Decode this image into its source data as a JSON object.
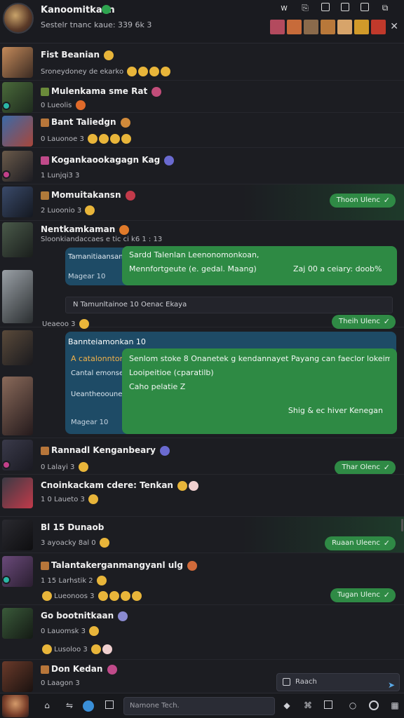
{
  "header": {
    "title": "Kanoomitkaan",
    "subtitle": "Sestelr tnanc kaue: 339 6k 3",
    "icons": [
      "wifi-icon",
      "clip-icon",
      "window-icon",
      "box-icon",
      "square-icon",
      "restore-icon"
    ],
    "thumb_colors": [
      "#b34a5e",
      "#c76b3a",
      "#8a6a4b",
      "#b8783a",
      "#d7a46a",
      "#d19a2a",
      "#c0392b"
    ]
  },
  "chats": [
    {
      "name": "Fist Beanian",
      "preview": "Sroneydoney de ekarko",
      "color": "#c48a5a"
    },
    {
      "name": "Mulenkama sme Rat",
      "preview": "0  Lueolis",
      "color": "#4a6a3a"
    },
    {
      "name": "Bant Taliedgn",
      "preview": "0  Lauonoe 3",
      "color": "#3a6aa8"
    },
    {
      "name": "Kogankaookagagn Kag",
      "preview": "1  Lunjqi3 3",
      "color": "#6a5a4a"
    },
    {
      "name": "Momuitakansn",
      "preview": "2  Luoonio 3",
      "color": "#3a4a6a",
      "pill": "Thoon Ulenc"
    },
    {
      "name": "Nentkamkaman",
      "preview": "Sloonkiandaccaes e tic ci k6 1 : 13",
      "color": "#4a5a4a"
    },
    {
      "name": "Rannadl Kenganbeary",
      "preview": "0  Lalayi 3",
      "color": "#3a3a4a"
    },
    {
      "name": "Cnoinkackam cdere: Tenkan",
      "preview": "1 0  Laueto 3",
      "color": "#3a3a44"
    },
    {
      "name": "Bl 15 Dunaob",
      "preview": "3  ayoacky 8al 0",
      "color": "#2a2a30",
      "pill": "Ruaan Uleenc"
    },
    {
      "name": "Talantakerganmangyanl ulg",
      "preview": "1  15  Larhstik 2",
      "color": "#6a4a7a",
      "pill": "Tugan Ulenc"
    },
    {
      "name": "Go bootnitkaan",
      "preview": "0  Lauomsk 3",
      "color": "#3a5a3a"
    },
    {
      "name": "Don Kedan",
      "preview": "0  Laagon 3",
      "color": "#6a3a2a"
    }
  ],
  "thread1": {
    "blue_title": "Tamanitiaansan",
    "blue_line": "Magear 10",
    "green_line1": "Sardd  Talenlan Leenonomonkoan,",
    "green_line2": "Mennfortgeute (e. gedal. Maang)",
    "green_line3": "Zaj 00 a ceiary: doob%",
    "sub": "N  Tamunltainoe 10  Oenac  Ekaya",
    "pill": "Theih Ulenc",
    "footer": "Ueaeoo 3"
  },
  "thread2": {
    "blue_title": "Bannteiamonkan 10",
    "blue_line1": "A catalonnton",
    "blue_line2": "Cantal emonse",
    "blue_line3": "Ueantheooune",
    "blue_line4": "Magear 10",
    "green_line1": "Senlom stoke 8 Onanetek g kendannayet Payang can faeclor lokeim",
    "green_line2": "Looipeitioe (cparatilb)",
    "green_line3": "Caho pelatie Z",
    "green_line4": "Shig & ec hiver Kenegan",
    "pill": "Thar Olenc"
  },
  "search": {
    "placeholder": "Raach"
  },
  "compose": {
    "placeholder": "Namone Tech."
  }
}
